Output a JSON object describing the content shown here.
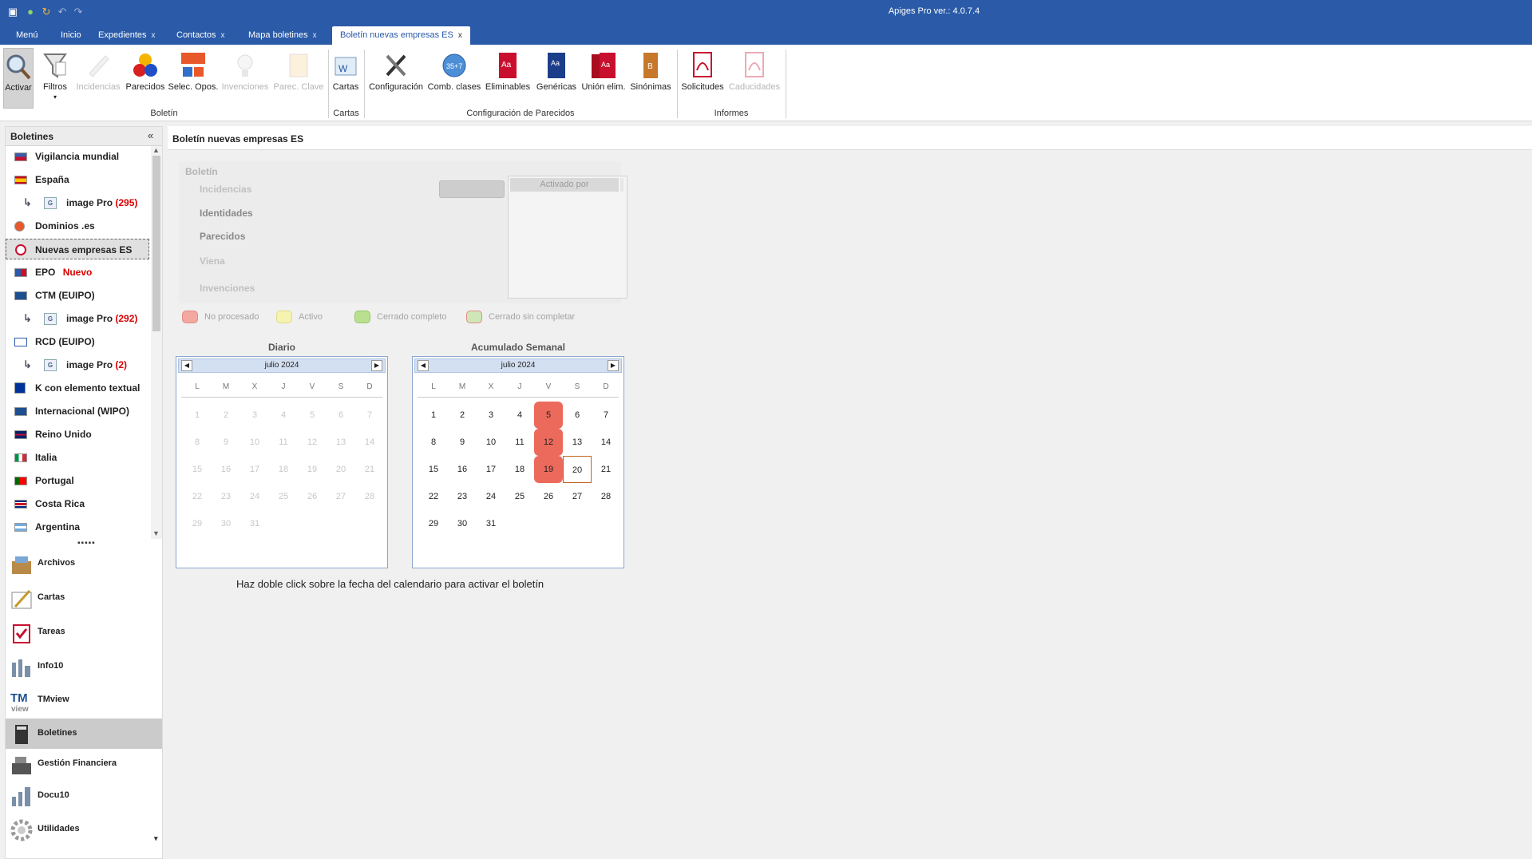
{
  "app": {
    "title": "Apiges Pro ver.: 4.0.7.4"
  },
  "tabs": [
    {
      "label": "Menú",
      "closable": false
    },
    {
      "label": "Inicio",
      "closable": false
    },
    {
      "label": "Expedientes",
      "closable": true
    },
    {
      "label": "Contactos",
      "closable": true
    },
    {
      "label": "Mapa boletines",
      "closable": true
    },
    {
      "label": "Boletín nuevas empresas ES",
      "closable": true,
      "active": true
    }
  ],
  "tab_close_glyph": "x",
  "ribbon": {
    "buttons": [
      {
        "label": "Activar",
        "icon": "magnifier-icon",
        "selected": true
      },
      {
        "label": "Filtros",
        "icon": "filter-icon",
        "dropdown": true
      },
      {
        "label": "Incidencias",
        "icon": "pencil-check-icon",
        "disabled": true
      },
      {
        "label": "Parecidos",
        "icon": "color-circles-icon"
      },
      {
        "label": "Selec. Opos.",
        "icon": "orgchart-icon"
      },
      {
        "label": "Invenciones",
        "icon": "lightbulb-icon",
        "disabled": true
      },
      {
        "label": "Parec. Clave",
        "icon": "key-doc-icon",
        "disabled": true
      },
      {
        "label": "Cartas",
        "icon": "word-letter-icon"
      },
      {
        "label": "Configuración",
        "icon": "tools-icon"
      },
      {
        "label": "Comb. clases",
        "icon": "classes-badge-icon"
      },
      {
        "label": "Eliminables",
        "icon": "red-book-icon"
      },
      {
        "label": "Genéricas",
        "icon": "blue-book-icon"
      },
      {
        "label": "Unión elim.",
        "icon": "red-books-icon"
      },
      {
        "label": "Sinónimas",
        "icon": "orange-book-icon"
      },
      {
        "label": "Solicitudes",
        "icon": "pdf-icon"
      },
      {
        "label": "Caducidades",
        "icon": "pdf-icon",
        "disabled": true
      }
    ],
    "groups": [
      "Boletín",
      "Cartas",
      "Configuración de Parecidos",
      "Informes"
    ]
  },
  "left_panel": {
    "title": "Boletines",
    "collapse_glyph": "«",
    "tree": [
      {
        "label": "Vigilancia mundial",
        "flag": "world"
      },
      {
        "label": "España",
        "flag": "es"
      },
      {
        "label": "image Pro",
        "count": "(295)",
        "child": true
      },
      {
        "label": "Dominios .es",
        "flag": "dominios"
      },
      {
        "label": "Nuevas empresas ES",
        "flag": "nuevas",
        "selected": true
      },
      {
        "label": "EPO",
        "badge": "Nuevo",
        "flag": "epo"
      },
      {
        "label": "CTM (EUIPO)",
        "flag": "ctm"
      },
      {
        "label": "image Pro",
        "count": "(292)",
        "child": true
      },
      {
        "label": "RCD (EUIPO)",
        "flag": "rcd"
      },
      {
        "label": "image Pro",
        "count": "(2)",
        "child": true
      },
      {
        "label": "K con elemento textual",
        "flag": "eu"
      },
      {
        "label": "Internacional (WIPO)",
        "flag": "wipo"
      },
      {
        "label": "Reino Unido",
        "flag": "uk"
      },
      {
        "label": "Italia",
        "flag": "it"
      },
      {
        "label": "Portugal",
        "flag": "pt"
      },
      {
        "label": "Costa Rica",
        "flag": "cr"
      },
      {
        "label": "Argentina",
        "flag": "ar"
      }
    ],
    "child_arrow": "↳",
    "child_doc": "G",
    "scroll_up": "▲",
    "scroll_down": "▼",
    "grip": "▪▪▪▪▪",
    "modules": [
      {
        "label": "Archivos",
        "icon": "archive-box-icon"
      },
      {
        "label": "Cartas",
        "icon": "letter-pen-icon"
      },
      {
        "label": "Tareas",
        "icon": "clipboard-check-icon"
      },
      {
        "label": "Info10",
        "icon": "info10-icon"
      },
      {
        "label": "TMview",
        "icon": "tmview-icon"
      },
      {
        "label": "Boletines",
        "icon": "bulletin-book-icon",
        "selected": true
      },
      {
        "label": "Gestión Financiera",
        "icon": "cash-register-icon"
      },
      {
        "label": "Docu10",
        "icon": "docu10-icon"
      },
      {
        "label": "Utilidades",
        "icon": "gear-icon"
      }
    ],
    "more_glyph": "▾"
  },
  "content": {
    "title": "Boletín nuevas empresas ES",
    "boletin": {
      "title": "Boletín",
      "rows": [
        "Incidencias",
        "Identidades",
        "Parecidos",
        "Viena",
        "Invenciones"
      ],
      "activado_por": "Activado por"
    },
    "legend": [
      {
        "label": "No procesado",
        "color": "#f3a9a1"
      },
      {
        "label": "Activo",
        "color": "#f6f2b0"
      },
      {
        "label": "Cerrado completo",
        "color": "#b9e08e"
      },
      {
        "label": "Cerrado sin completar",
        "color": "#cfe7b6"
      }
    ],
    "calendars": [
      {
        "title": "Diario",
        "month": "julio 2024",
        "disabled": true,
        "day_headers": [
          "L",
          "M",
          "X",
          "J",
          "V",
          "S",
          "D"
        ],
        "highlighted": [],
        "today": null
      },
      {
        "title": "Acumulado Semanal",
        "month": "julio 2024",
        "disabled": false,
        "day_headers": [
          "L",
          "M",
          "X",
          "J",
          "V",
          "S",
          "D"
        ],
        "highlighted": [
          5,
          12,
          19
        ],
        "today": 20
      }
    ],
    "calendar_days_in_month": 31,
    "calendar_first_weekday_index": 0,
    "cal_prev": "◀",
    "cal_next": "▶",
    "note": "Haz doble click sobre la fecha del calendario para activar el boletín"
  },
  "colors": {
    "accent": "#2a5aa8",
    "highlight_day": "#ec6a5c",
    "today_border": "#c4661f",
    "count_red": "#d90000"
  }
}
